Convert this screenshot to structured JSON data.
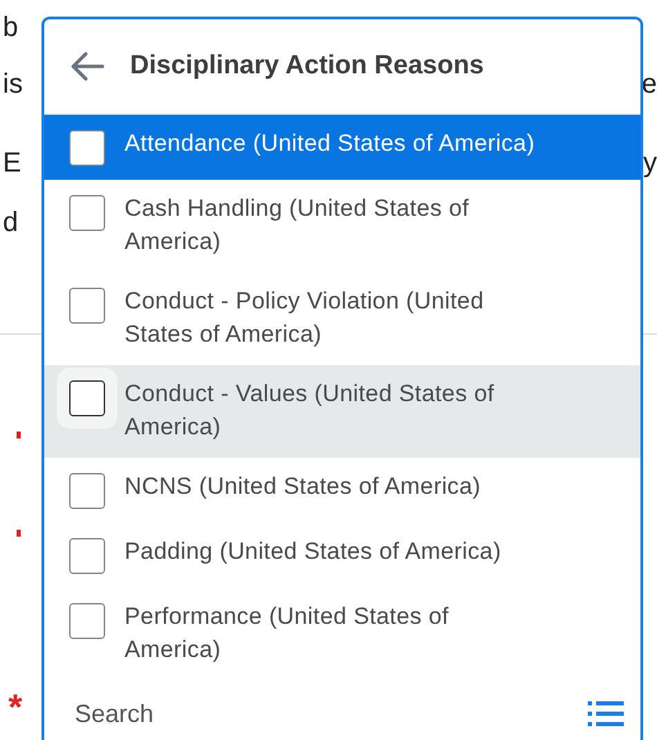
{
  "background": {
    "lines": [
      {
        "left": "b"
      },
      {
        "left": "is",
        "right": "e"
      },
      {
        "left": "E",
        "right": "y"
      },
      {
        "left": "d"
      }
    ],
    "required_mark": "*"
  },
  "popup": {
    "title": "Disciplinary Action Reasons",
    "options": [
      {
        "label": "Attendance (United States of America)",
        "checked": false,
        "highlighted": true,
        "hovered": false
      },
      {
        "label": "Cash Handling (United States of America)",
        "checked": false,
        "highlighted": false,
        "hovered": false
      },
      {
        "label": "Conduct - Policy Violation (United States of America)",
        "checked": false,
        "highlighted": false,
        "hovered": false
      },
      {
        "label": "Conduct - Values (United States of America)",
        "checked": false,
        "highlighted": false,
        "hovered": true
      },
      {
        "label": "NCNS (United States of America)",
        "checked": false,
        "highlighted": false,
        "hovered": false
      },
      {
        "label": "Padding (United States of America)",
        "checked": false,
        "highlighted": false,
        "hovered": false
      },
      {
        "label": "Performance (United States of America)",
        "checked": false,
        "highlighted": false,
        "hovered": false
      }
    ]
  },
  "search": {
    "placeholder": "Search"
  }
}
